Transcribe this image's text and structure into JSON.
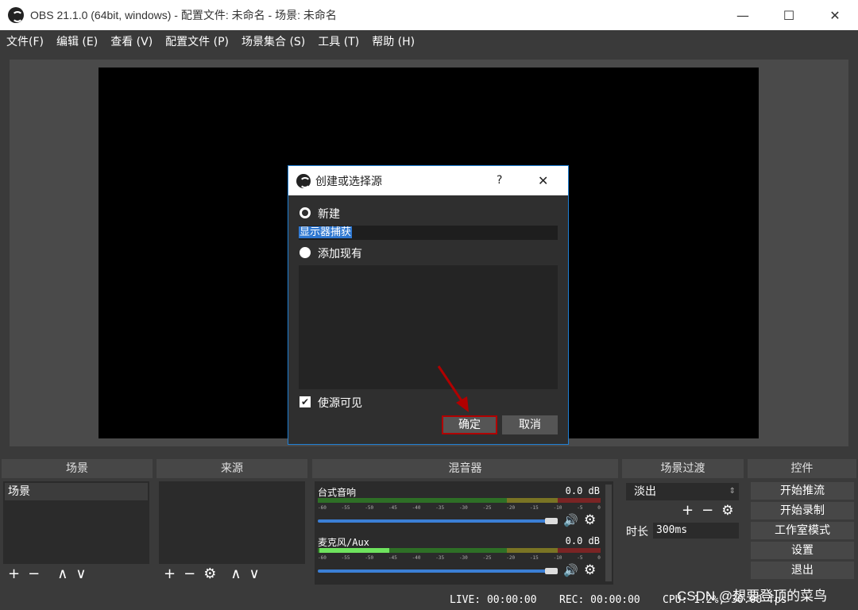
{
  "window": {
    "title": "OBS 21.1.0 (64bit, windows) - 配置文件: 未命名 - 场景: 未命名",
    "minimize": "—",
    "maximize": "☐",
    "close": "✕"
  },
  "menu": [
    "文件(F)",
    "编辑 (E)",
    "查看 (V)",
    "配置文件 (P)",
    "场景集合 (S)",
    "工具 (T)",
    "帮助 (H)"
  ],
  "docks": {
    "scenes": "场景",
    "sources": "来源",
    "mixer": "混音器",
    "transitions": "场景过渡",
    "controls": "控件"
  },
  "scenes": {
    "items": [
      "场景"
    ]
  },
  "mixer": {
    "tracks": [
      {
        "name": "台式音响",
        "db": "0.0 dB"
      },
      {
        "name": "麦克风/Aux",
        "db": "0.0 dB"
      }
    ],
    "ticks": [
      "-60",
      "-55",
      "-50",
      "-45",
      "-40",
      "-35",
      "-30",
      "-25",
      "-20",
      "-15",
      "-10",
      "-5",
      "0"
    ]
  },
  "transitions": {
    "selected": "淡出",
    "duration_label": "时长",
    "duration_value": "300ms"
  },
  "controls": [
    "开始推流",
    "开始录制",
    "工作室模式",
    "设置",
    "退出"
  ],
  "status": {
    "live": "LIVE: 00:00:00",
    "rec": "REC: 00:00:00",
    "cpu": "CPU: 1.2%, 30.00 fps"
  },
  "dialog": {
    "title": "创建或选择源",
    "help": "?",
    "close": "✕",
    "new_label": "新建",
    "new_value": "显示器捕获",
    "existing_label": "添加现有",
    "visible_label": "使源可见",
    "ok": "确定",
    "cancel": "取消"
  },
  "watermark": "CSDN @想要登顶的菜鸟",
  "colors": {
    "accent": "#3b7fd6",
    "highlight_border": "#b00000"
  }
}
